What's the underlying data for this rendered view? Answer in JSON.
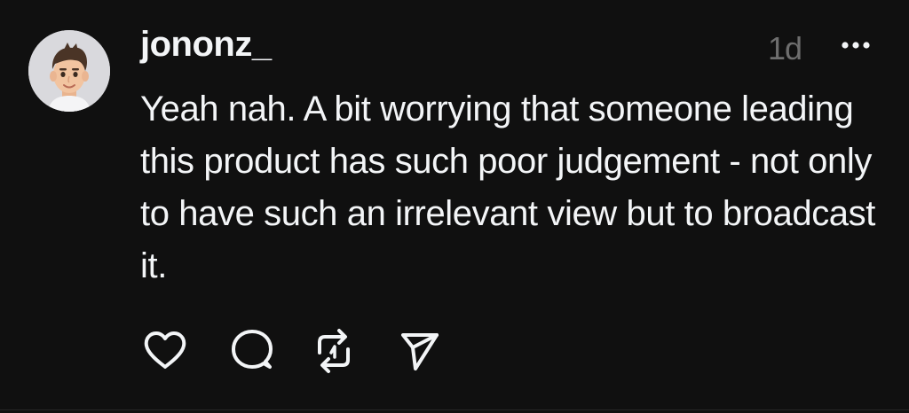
{
  "post": {
    "username": "jononz_",
    "timestamp": "1d",
    "text": "Yeah nah. A bit worrying that someone leading this product has such poor judgement - not only to have such an irrelevant view but to broadcast it."
  },
  "icons": {
    "avatar": "memoji-avatar",
    "more": "more-horizontal-icon",
    "like": "heart-icon",
    "reply": "comment-icon",
    "repost": "repost-icon",
    "share": "send-icon"
  },
  "colors": {
    "background": "#101010",
    "text": "#f3f5f7",
    "muted": "#6e6e6e"
  }
}
